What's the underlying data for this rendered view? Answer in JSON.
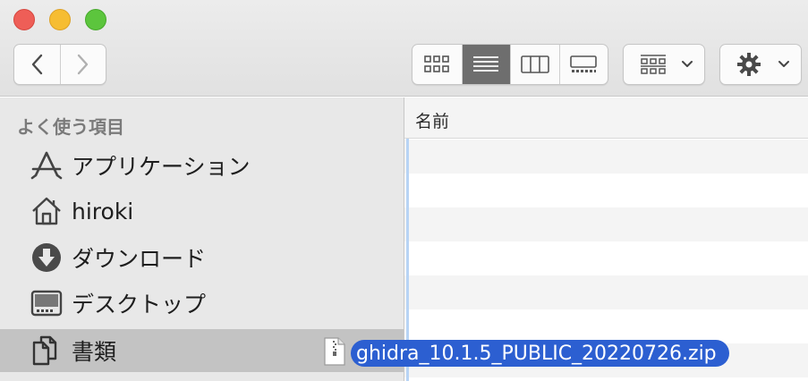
{
  "sidebar": {
    "heading": "よく使う項目",
    "items": [
      {
        "label": "アプリケーション",
        "icon": "applications-icon"
      },
      {
        "label": "hiroki",
        "icon": "home-icon"
      },
      {
        "label": "ダウンロード",
        "icon": "downloads-icon"
      },
      {
        "label": "デスクトップ",
        "icon": "desktop-icon"
      },
      {
        "label": "書類",
        "icon": "documents-icon",
        "selected": true
      }
    ]
  },
  "content": {
    "column_header": "名前"
  },
  "drag": {
    "filename": "ghidra_10.1.5_PUBLIC_20220726.zip"
  },
  "colors": {
    "selection": "#2c5fd1",
    "sidebar_bg": "#e8e8e8",
    "selected_row": "#c3c3c3",
    "active_view": "#6e6e6e"
  }
}
